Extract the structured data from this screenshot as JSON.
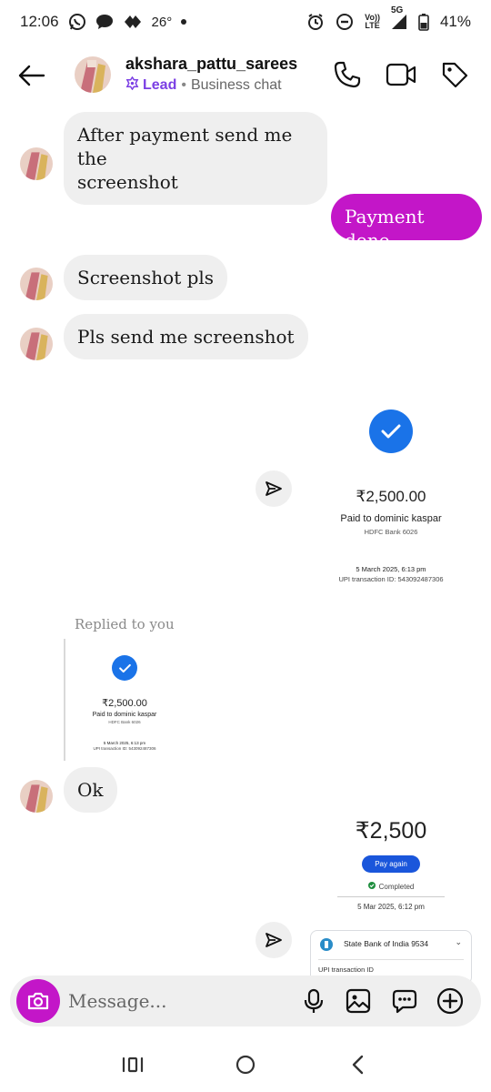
{
  "status_bar": {
    "time": "12:06",
    "temperature": "26°",
    "network_label_top": "Vo))",
    "network_label_bottom": "LTE",
    "network_type": "5G",
    "battery": "41%"
  },
  "header": {
    "contact_name": "akshara_pattu_sarees",
    "lead_label": "Lead",
    "chat_type": "Business chat"
  },
  "messages": {
    "m1_line1": "After payment send me the",
    "m1_line2": "screenshot",
    "m2": "Payment done",
    "m3": "Screenshot pls",
    "m4": "Pls send me screenshot",
    "m6": "Ok"
  },
  "receipt1": {
    "amount": "₹2,500.00",
    "paid_to": "Paid to dominic kaspar",
    "bank": "HDFC Bank 6026",
    "datetime": "5 March 2025, 6:13 pm",
    "upi_id": "UPI transaction ID: 543092487306"
  },
  "reply": {
    "label": "Replied to you",
    "amount": "₹2,500.00",
    "paid_to": "Paid to dominic kaspar",
    "bank": "HDFC Bank 6026",
    "datetime": "5 March 2025, 6:13 pm",
    "upi_id": "UPI transaction ID: 543092487306"
  },
  "receipt2": {
    "amount": "₹2,500",
    "pay_again": "Pay again",
    "status": "Completed",
    "datetime": "5 Mar 2025, 6:12 pm",
    "bank_name": "State Bank of India 9534",
    "upi_label": "UPI transaction ID"
  },
  "composer": {
    "placeholder": "Message..."
  },
  "colors": {
    "accent": "#c316c8",
    "lead": "#7b3fe4",
    "gpay_blue": "#1a73e8",
    "completed_green": "#1e8e3e"
  }
}
